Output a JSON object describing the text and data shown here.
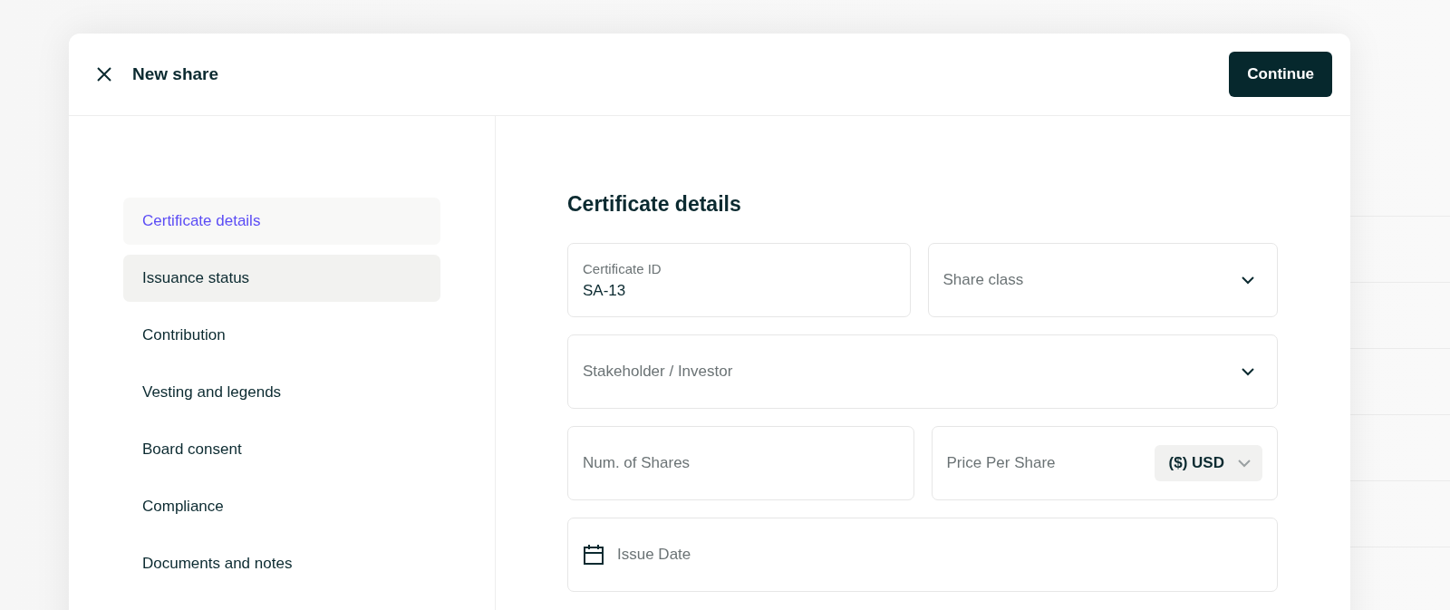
{
  "dialog": {
    "title": "New share",
    "primary_button": "Continue"
  },
  "steps": [
    {
      "label": "Certificate details",
      "selected": true,
      "hovered": false
    },
    {
      "label": "Issuance status",
      "selected": false,
      "hovered": true
    },
    {
      "label": "Contribution",
      "selected": false,
      "hovered": false
    },
    {
      "label": "Vesting and legends",
      "selected": false,
      "hovered": false
    },
    {
      "label": "Board consent",
      "selected": false,
      "hovered": false
    },
    {
      "label": "Compliance",
      "selected": false,
      "hovered": false
    },
    {
      "label": "Documents and notes",
      "selected": false,
      "hovered": false
    }
  ],
  "section": {
    "title": "Certificate details"
  },
  "field_rows": [
    [
      {
        "kind": "text",
        "label": "Certificate ID",
        "value": "SA-13"
      },
      {
        "kind": "select",
        "placeholder": "Share class"
      }
    ],
    [
      {
        "kind": "select",
        "placeholder": "Stakeholder / Investor"
      }
    ],
    [
      {
        "kind": "text",
        "placeholder": "Num. of Shares"
      },
      {
        "kind": "currency",
        "placeholder": "Price Per Share",
        "currency": "($) USD"
      }
    ],
    [
      {
        "kind": "date",
        "placeholder": "Issue Date"
      }
    ]
  ]
}
